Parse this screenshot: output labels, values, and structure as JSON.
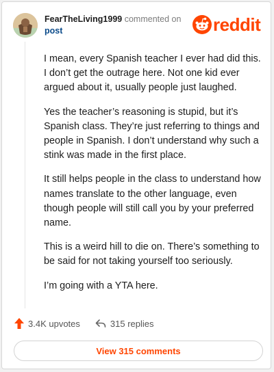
{
  "header": {
    "username": "FearTheLiving1999",
    "action": "commented on",
    "post_link": "post",
    "logo_text": "reddit",
    "logo_icon": "reddit-snoo-icon",
    "avatar_icon": "avatar-image"
  },
  "comment": {
    "paragraphs": [
      "I mean, every Spanish teacher I ever had did this. I don’t get the outrage here. Not one kid ever argued about it, usually people just laughed.",
      "Yes the teacher’s reasoning is stupid, but it’s Spanish class. They’re just referring to things and people in Spanish. I don’t understand why such a stink was made in the first place.",
      "It still helps people in the class to understand how names translate to the other language, even though people will still call you by your preferred name.",
      "This is a weird hill to die on. There’s something to be said for not taking yourself too seriously.",
      "I’m going with a YTA here."
    ]
  },
  "actions": {
    "upvotes": "3.4K upvotes",
    "upvote_icon": "upvote-arrow-icon",
    "replies": "315 replies",
    "reply_icon": "reply-arrow-icon"
  },
  "view_comments_label": "View 315 comments",
  "colors": {
    "brand": "#ff4500",
    "link": "#0a4a8a",
    "text": "#1c1c1c"
  }
}
